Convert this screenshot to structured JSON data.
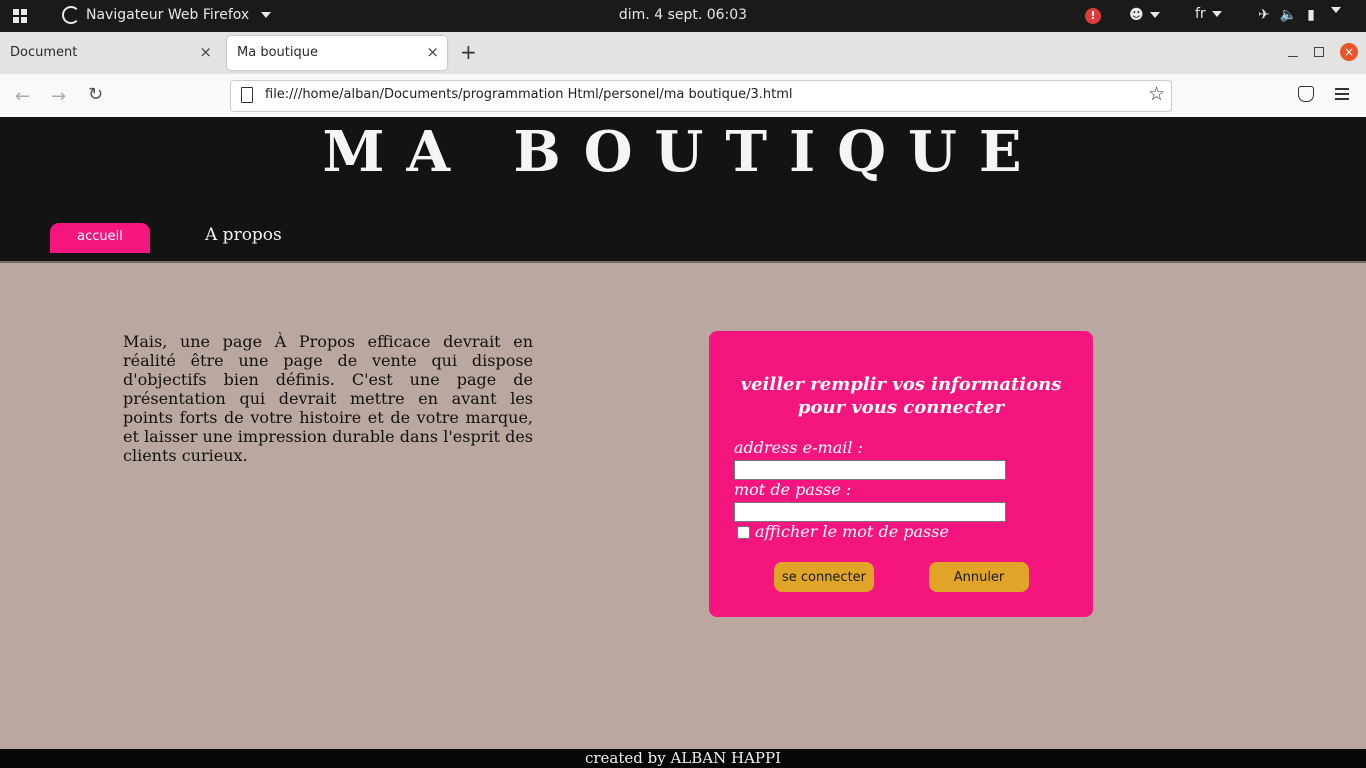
{
  "system_bar": {
    "app_name": "Navigateur Web Firefox",
    "datetime": "dim. 4 sept. 06:03",
    "alert_symbol": "!",
    "language": "fr"
  },
  "browser": {
    "tabs": [
      {
        "label": "Document",
        "active": false
      },
      {
        "label": "Ma boutique",
        "active": true
      }
    ],
    "url": "file:///home/alban/Documents/programmation Html/personel/ma boutique/3.html"
  },
  "page": {
    "site_title": "MA BOUTIQUE",
    "nav": {
      "home_label": "accueil",
      "about_label": "A propos"
    },
    "about_text": "Mais, une page À Propos efficace devrait en réalité être une page de vente qui dispose d'objectifs bien définis. C'est une page de présentation qui devrait mettre en avant les points forts de votre histoire et de votre marque, et laisser une impression durable dans l'esprit des clients curieux.",
    "login": {
      "title": "veiller remplir vos informations pour vous connecter",
      "email_label": "address e-mail :",
      "email_value": "",
      "password_label": "mot de passe :",
      "password_value": "",
      "show_password_label": "afficher le mot de passe",
      "show_password_checked": false,
      "connect_button": "se connecter",
      "cancel_button": "Annuler"
    },
    "footer": "created by ALBAN HAPPI"
  },
  "colors": {
    "accent_pink": "#f5157f",
    "button_gold": "#e0a428",
    "page_background": "#baa8a0",
    "header_background": "#131313"
  }
}
